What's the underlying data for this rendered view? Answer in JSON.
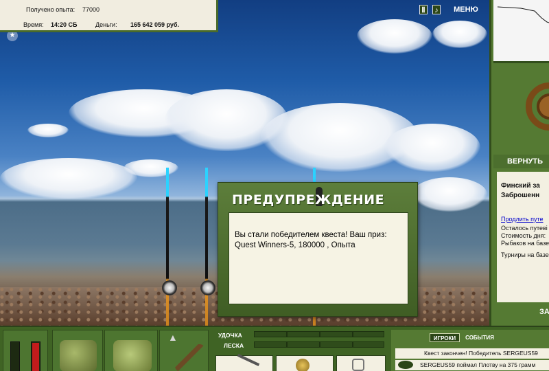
{
  "info": {
    "exp_label": "Получено опыта:",
    "exp_value": "77000",
    "time_label": "Время:",
    "time_value": "14:20 СБ",
    "money_label": "Деньги:",
    "money_value": "165 642 059 руб."
  },
  "topbar": {
    "pause_icon": "pause-icon",
    "sound_icon": "sound-icon",
    "menu_label": "МЕНЮ"
  },
  "right_panel": {
    "return_label": "ВЕРНУТЬ",
    "location_line1": "Финский за",
    "location_line2": "Заброшенн",
    "extend_link": "Продлить путе",
    "remaining": "Осталось путеві",
    "day_cost": "Стоимость дня:",
    "fishers": "Рыбаков на базе",
    "tournaments": "Турниры на базе",
    "bottom_label": "ЗА"
  },
  "dialog": {
    "title": "ПРЕДУПРЕЖДЕНИЕ",
    "message_line1": "Вы стали победителем квеста! Ваш приз:",
    "message_line2": "Quest Winners-5, 180000 , Опыта"
  },
  "bottom": {
    "rod_label": "УДОЧКА",
    "line_label": "ЛЕСКА",
    "rod_fill": 0,
    "line_fill": 0,
    "meter_left_color": "#1d2a12",
    "meter_right_color": "#c21c1c",
    "tabs": {
      "players": "ИГРОКИ",
      "events": "СОБЫТИЯ"
    },
    "chat": [
      "Квест закончен! Победитель SERGEUS59",
      "SERGEUS59 поймал Плотву на 375 грамм"
    ]
  },
  "colors": {
    "panel_green": "#557a33",
    "dark_green": "#324d1c",
    "cream": "#f3f0e2",
    "link_blue": "#0000cc"
  }
}
